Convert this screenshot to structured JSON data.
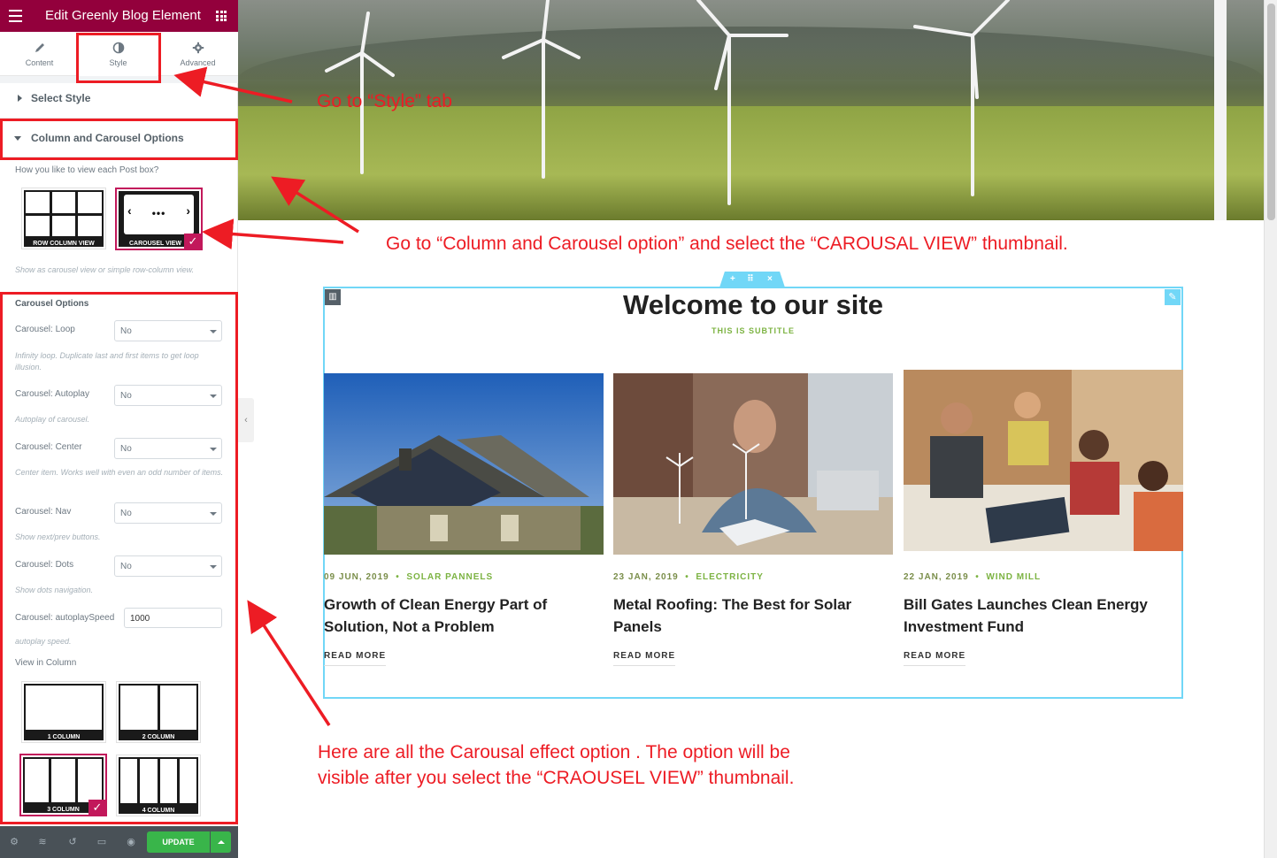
{
  "sidebar": {
    "title": "Edit Greenly Blog Element",
    "tabs": [
      {
        "label": "Content",
        "icon": "pencil-icon"
      },
      {
        "label": "Style",
        "icon": "half-circle-icon"
      },
      {
        "label": "Advanced",
        "icon": "gear-icon"
      }
    ],
    "sections": {
      "select_style": "Select Style",
      "column_carousel": "Column and Carousel Options"
    },
    "view_question": "How you like to view each Post box?",
    "view_thumbs": [
      {
        "label": "ROW COLUMN VIEW",
        "selected": false
      },
      {
        "label": "CAROUSEL VIEW",
        "selected": true
      }
    ],
    "view_hint": "Show as carousel view or simple row-column view.",
    "carousel_title": "Carousel Options",
    "controls": [
      {
        "label": "Carousel: Loop",
        "value": "No",
        "hint": "Infinity loop. Duplicate last and first items to get loop illusion."
      },
      {
        "label": "Carousel: Autoplay",
        "value": "No",
        "hint": "Autoplay of carousel."
      },
      {
        "label": "Carousel: Center",
        "value": "No",
        "hint": "Center item. Works well with even an odd number of items."
      },
      {
        "label": "Carousel: Nav",
        "value": "No",
        "hint": "Show next/prev buttons."
      },
      {
        "label": "Carousel: Dots",
        "value": "No",
        "hint": "Show dots navigation."
      }
    ],
    "autoplay_speed": {
      "label": "Carousel: autoplaySpeed",
      "value": "1000",
      "hint": "autoplay speed."
    },
    "view_in_column": "View in Column",
    "column_thumbs": [
      {
        "label": "1 COLUMN",
        "cols": 1,
        "selected": false
      },
      {
        "label": "2 COLUMN",
        "cols": 2,
        "selected": false
      },
      {
        "label": "3 COLUMN",
        "cols": 3,
        "selected": true
      },
      {
        "label": "4 COLUMN",
        "cols": 4,
        "selected": false
      }
    ],
    "footer": {
      "update_label": "UPDATE"
    }
  },
  "canvas": {
    "heading": "Welcome to our site",
    "subtitle": "THIS IS SUBTITLE",
    "posts": [
      {
        "date": "09 JUN, 2019",
        "category": "SOLAR PANNELS",
        "title": "Growth of Clean Energy Part of Solution, Not a Problem",
        "more": "READ MORE"
      },
      {
        "date": "23 JAN, 2019",
        "category": "ELECTRICITY",
        "title": "Metal Roofing: The Best for Solar Panels",
        "more": "READ MORE"
      },
      {
        "date": "22 JAN, 2019",
        "category": "WIND MILL",
        "title": "Bill Gates Launches Clean Energy Investment Fund",
        "more": "READ MORE"
      }
    ]
  },
  "annotations": {
    "style_tab": "Go  to “Style” tab",
    "column_carousel": "Go to “Column and Carousel option” and select the “CAROUSAL VIEW” thumbnail.",
    "options_line1": "Here are all the Carousal effect option . The option will be",
    "options_line2": "visible after you select the “CRAOUSEL VIEW” thumbnail."
  },
  "colors": {
    "header_bg": "#93003c",
    "accent_green": "#7cb342",
    "update_green": "#39b54a",
    "annotation_red": "#ed1c24",
    "section_outline": "#71d7f7",
    "selected_pink": "#c2185b"
  }
}
